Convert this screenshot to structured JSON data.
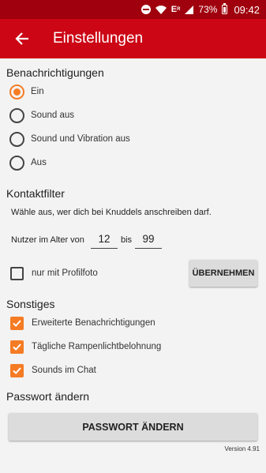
{
  "statusbar": {
    "battery": "73%",
    "time": "09:42"
  },
  "appbar": {
    "title": "Einstellungen"
  },
  "notifications": {
    "title": "Benachrichtigungen",
    "options": [
      "Ein",
      "Sound aus",
      "Sound und Vibration aus",
      "Aus"
    ],
    "selected": "Ein"
  },
  "contact_filter": {
    "title": "Kontaktfilter",
    "description": "Wähle aus, wer dich bei Knuddels anschreiben darf.",
    "age_label": "Nutzer im Alter von",
    "age_from": "12",
    "age_between": "bis",
    "age_to": "99",
    "profile_photo_label": "nur mit Profilfoto",
    "profile_photo_checked": false,
    "apply_button": "ÜBERNEHMEN"
  },
  "misc": {
    "title": "Sonstiges",
    "options": [
      {
        "label": "Erweiterte Benachrichtigungen",
        "checked": true
      },
      {
        "label": "Tägliche Rampenlichtbelohnung",
        "checked": true
      },
      {
        "label": "Sounds im Chat",
        "checked": true
      }
    ]
  },
  "password": {
    "title": "Passwort ändern",
    "button": "PASSWORT ÄNDERN"
  },
  "version": "Version 4.91",
  "colors": {
    "appbar": "#cc0615",
    "statusbar": "#a0000d",
    "accent": "#f57c24"
  }
}
